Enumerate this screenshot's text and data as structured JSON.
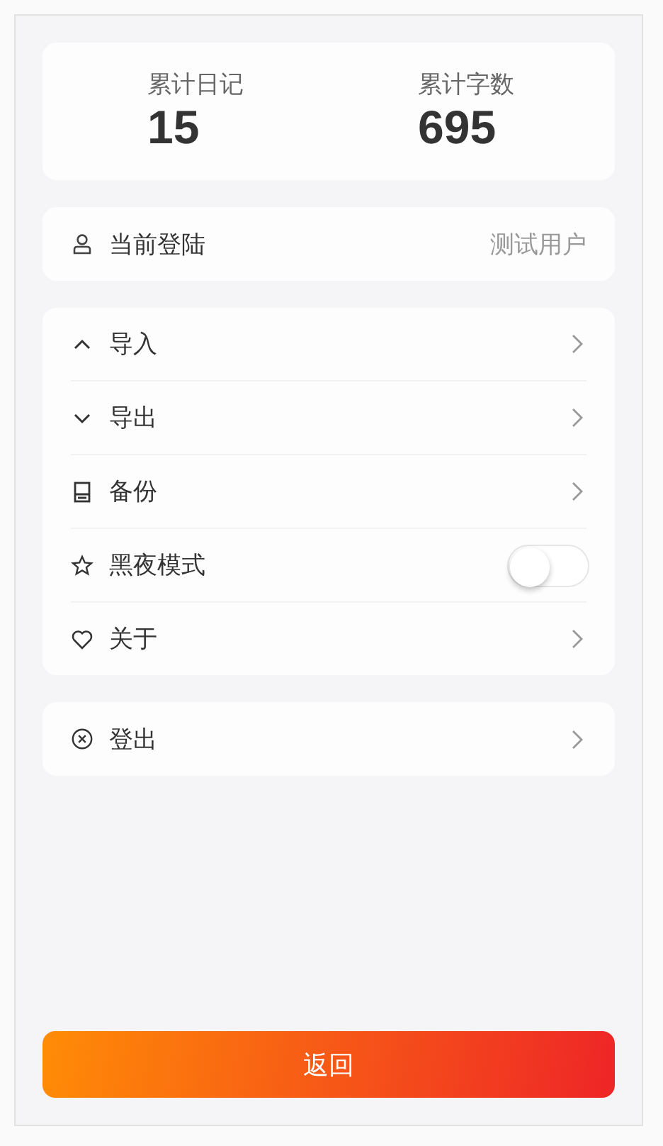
{
  "stats": [
    {
      "label": "累计日记",
      "value": "15"
    },
    {
      "label": "累计字数",
      "value": "695"
    }
  ],
  "account": {
    "label": "当前登陆",
    "value": "测试用户"
  },
  "menu": [
    {
      "kind": "link",
      "label": "导入"
    },
    {
      "kind": "link",
      "label": "导出"
    },
    {
      "kind": "link",
      "label": "备份"
    },
    {
      "kind": "toggle",
      "label": "黑夜模式",
      "on": false
    },
    {
      "kind": "link",
      "label": "关于"
    }
  ],
  "logout": {
    "label": "登出"
  },
  "back_button": "返回"
}
